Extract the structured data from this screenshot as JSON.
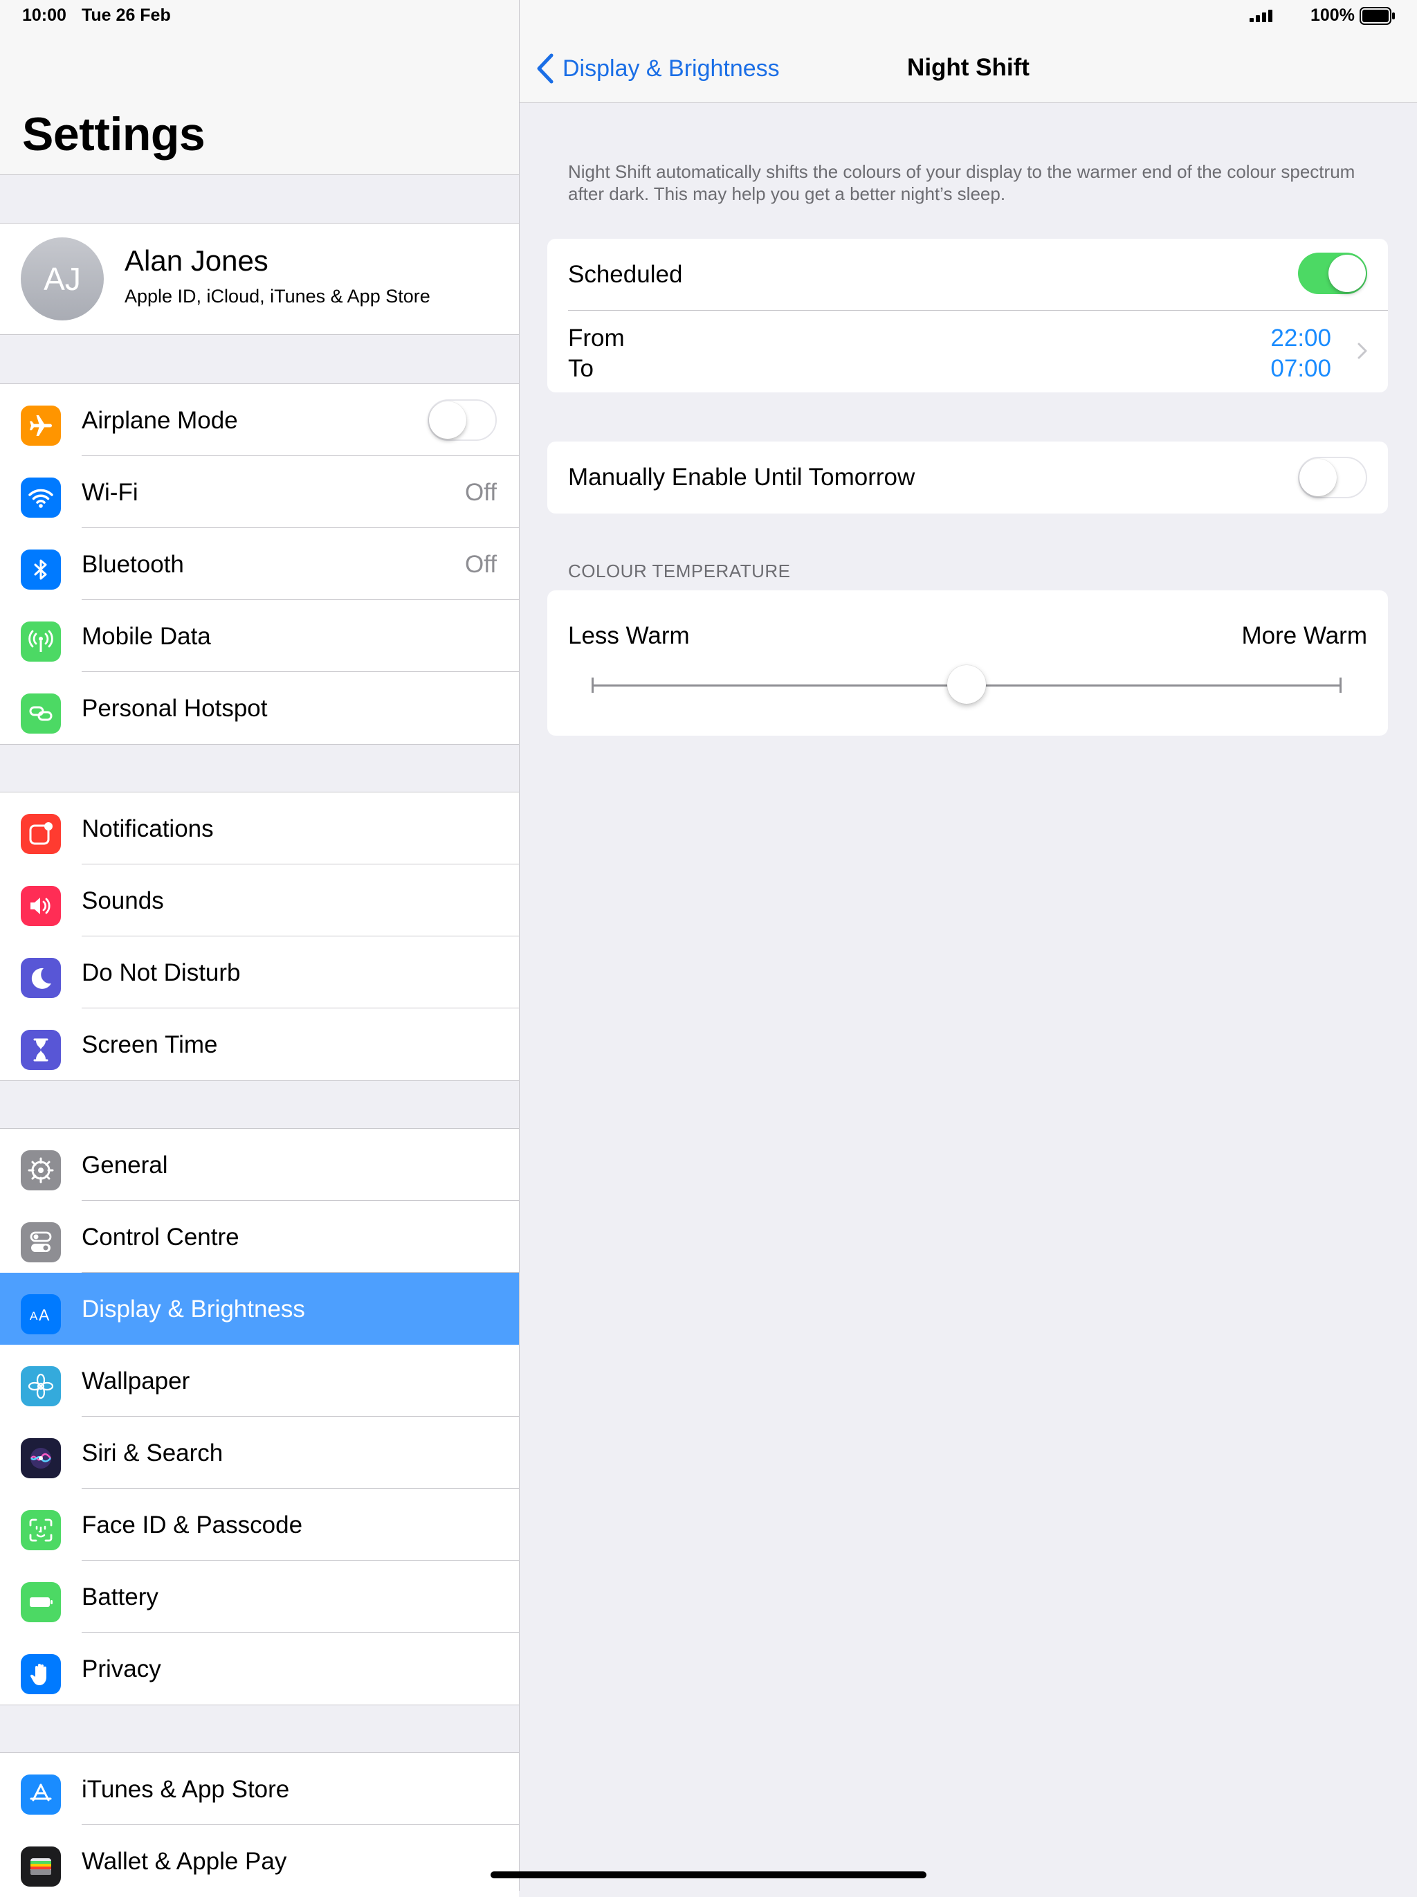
{
  "status_bar": {
    "time": "10:00",
    "date": "Tue 26 Feb",
    "battery": "100%"
  },
  "settings": {
    "title": "Settings",
    "profile": {
      "initials": "AJ",
      "name": "Alan Jones",
      "subtitle": "Apple ID, iCloud, iTunes & App Store"
    },
    "groups": [
      {
        "items": [
          {
            "label": "Airplane Mode",
            "icon": "airplane-icon",
            "color": "#ff9500",
            "toggle": "off"
          },
          {
            "label": "Wi-Fi",
            "icon": "wifi-icon",
            "color": "#007aff",
            "value": "Off"
          },
          {
            "label": "Bluetooth",
            "icon": "bluetooth-icon",
            "color": "#007aff",
            "value": "Off"
          },
          {
            "label": "Mobile Data",
            "icon": "antenna-icon",
            "color": "#4cd964"
          },
          {
            "label": "Personal Hotspot",
            "icon": "hotspot-icon",
            "color": "#4cd964"
          }
        ]
      },
      {
        "items": [
          {
            "label": "Notifications",
            "icon": "notifications-icon",
            "color": "#ff3b30"
          },
          {
            "label": "Sounds",
            "icon": "speaker-icon",
            "color": "#ff2d55"
          },
          {
            "label": "Do Not Disturb",
            "icon": "moon-icon",
            "color": "#5856d6"
          },
          {
            "label": "Screen Time",
            "icon": "hourglass-icon",
            "color": "#5856d6"
          }
        ]
      },
      {
        "items": [
          {
            "label": "General",
            "icon": "gear-icon",
            "color": "#8e8e93"
          },
          {
            "label": "Control Centre",
            "icon": "switches-icon",
            "color": "#8e8e93"
          },
          {
            "label": "Display & Brightness",
            "icon": "text-size-icon",
            "color": "#007aff",
            "selected": true
          },
          {
            "label": "Wallpaper",
            "icon": "flower-icon",
            "color": "#34aadc"
          },
          {
            "label": "Siri & Search",
            "icon": "siri-icon",
            "color": "#1c1c3a"
          },
          {
            "label": "Face ID & Passcode",
            "icon": "face-id-icon",
            "color": "#4cd964"
          },
          {
            "label": "Battery",
            "icon": "battery-icon",
            "color": "#4cd964"
          },
          {
            "label": "Privacy",
            "icon": "hand-icon",
            "color": "#007aff"
          }
        ]
      },
      {
        "items": [
          {
            "label": "iTunes & App Store",
            "icon": "app-store-icon",
            "color": "#1a8cff"
          },
          {
            "label": "Wallet & Apple Pay",
            "icon": "wallet-icon",
            "color": "#1c1c1e"
          }
        ]
      }
    ]
  },
  "night_shift": {
    "back_label": "Display & Brightness",
    "title": "Night Shift",
    "description": "Night Shift automatically shifts the colours of your display to the warmer end of the colour spectrum after dark. This may help you get a better night’s sleep.",
    "scheduled_label": "Scheduled",
    "scheduled_on": true,
    "from_label": "From",
    "to_label": "To",
    "from_time": "22:00",
    "to_time": "07:00",
    "manual_label": "Manually Enable Until Tomorrow",
    "manual_on": false,
    "colour_temp_header": "COLOUR TEMPERATURE",
    "less_warm": "Less Warm",
    "more_warm": "More Warm",
    "temperature_level": 0.5
  }
}
